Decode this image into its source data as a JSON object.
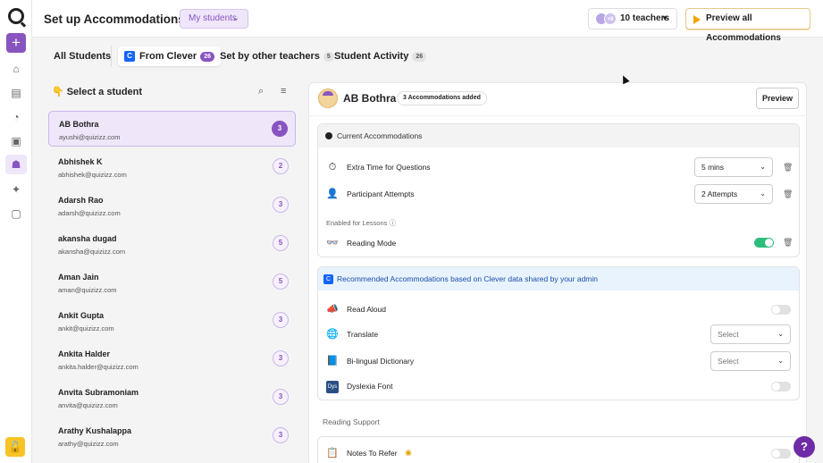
{
  "header": {
    "title": "Set up Accommodations for",
    "scope_select": "My students",
    "teachers_count_badge": "+8",
    "teachers_label": "10 teachers",
    "preview_all": "Preview all Accommodations"
  },
  "tabs": [
    {
      "label": "All Students",
      "badge": ""
    },
    {
      "label": "From Clever",
      "badge": "26"
    },
    {
      "label": "Set by other teachers",
      "badge": "5"
    },
    {
      "label": "Student Activity",
      "badge": "26"
    }
  ],
  "student_list": {
    "heading": "Select a student",
    "hand_emoji": "👇",
    "students": [
      {
        "name": "AB Bothra",
        "email": "ayushi@quizizz.com",
        "count": "3"
      },
      {
        "name": "Abhishek K",
        "email": "abhishek@quizizz.com",
        "count": "2"
      },
      {
        "name": "Adarsh Rao",
        "email": "adarsh@quizizz.com",
        "count": "3"
      },
      {
        "name": "akansha dugad",
        "email": "akansha@quizizz.com",
        "count": "5"
      },
      {
        "name": "Aman Jain",
        "email": "aman@quizizz.com",
        "count": "5"
      },
      {
        "name": "Ankit Gupta",
        "email": "ankit@quizizz.com",
        "count": "3"
      },
      {
        "name": "Ankita Halder",
        "email": "ankita.halder@quizizz.com",
        "count": "3"
      },
      {
        "name": "Anvita Subramoniam",
        "email": "anvita@quizizz.com",
        "count": "3"
      },
      {
        "name": "Arathy Kushalappa",
        "email": "arathy@quizizz.com",
        "count": "3"
      }
    ]
  },
  "detail": {
    "student_name": "AB Bothra",
    "added_badge": "3 Accommodations added",
    "preview": "Preview",
    "current": {
      "heading": "Current Accommodations",
      "extra_time_label": "Extra Time for Questions",
      "extra_time_value": "5 mins",
      "attempts_label": "Participant Attempts",
      "attempts_value": "2 Attempts",
      "lessons_section": "Enabled for Lessons",
      "reading_mode_label": "Reading Mode"
    },
    "recommended": {
      "heading": "Recommended Accommodations based on Clever data shared by your admin",
      "read_aloud_label": "Read Aloud",
      "translate_label": "Translate",
      "translate_placeholder": "Select",
      "dictionary_label": "Bi-lingual Dictionary",
      "dictionary_placeholder": "Select",
      "dyslexia_label": "Dyslexia Font",
      "dyslexia_icon_text": "Dys"
    },
    "reading_support": {
      "heading": "Reading Support",
      "notes_label": "Notes To Refer"
    }
  },
  "help_label": "?",
  "colors": {
    "brand": "#8854c0",
    "clever": "#1464ff",
    "toggle_on": "#2dbe7e"
  }
}
